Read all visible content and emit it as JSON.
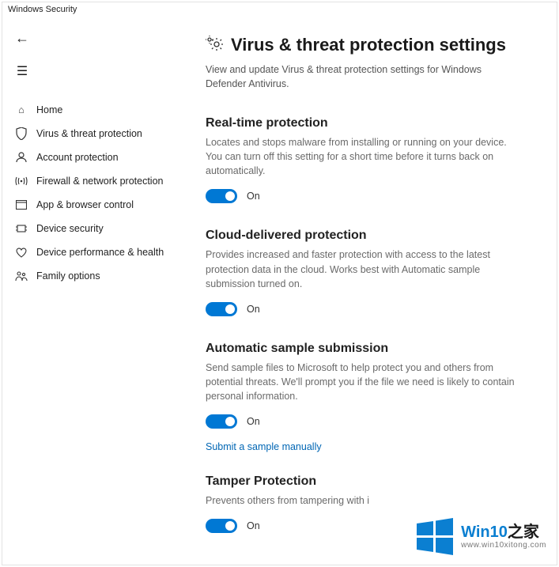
{
  "app_title": "Windows Security",
  "nav": {
    "items": [
      {
        "label": "Home"
      },
      {
        "label": "Virus & threat protection"
      },
      {
        "label": "Account protection"
      },
      {
        "label": "Firewall & network protection"
      },
      {
        "label": "App & browser control"
      },
      {
        "label": "Device security"
      },
      {
        "label": "Device performance & health"
      },
      {
        "label": "Family options"
      }
    ]
  },
  "page": {
    "title": "Virus & threat protection settings",
    "subtitle": "View and update Virus & threat protection settings for Windows Defender Antivirus."
  },
  "sections": {
    "realtime": {
      "title": "Real-time protection",
      "desc": "Locates and stops malware from installing or running on your device. You can turn off this setting for a short time before it turns back on automatically.",
      "toggle_label": "On"
    },
    "cloud": {
      "title": "Cloud-delivered protection",
      "desc": "Provides increased and faster protection with access to the latest protection data in the cloud.  Works best with Automatic sample submission turned on.",
      "toggle_label": "On"
    },
    "sample": {
      "title": "Automatic sample submission",
      "desc": "Send sample files to Microsoft to help protect you and others from potential threats.  We'll prompt you if the file we need is likely to contain personal information.",
      "toggle_label": "On",
      "link": "Submit a sample manually"
    },
    "tamper": {
      "title": "Tamper Protection",
      "desc": "Prevents others from tampering with i",
      "toggle_label": "On"
    }
  },
  "watermark": {
    "brand_prefix": "Win10",
    "brand_suffix": "之家",
    "url": "www.win10xitong.com"
  }
}
